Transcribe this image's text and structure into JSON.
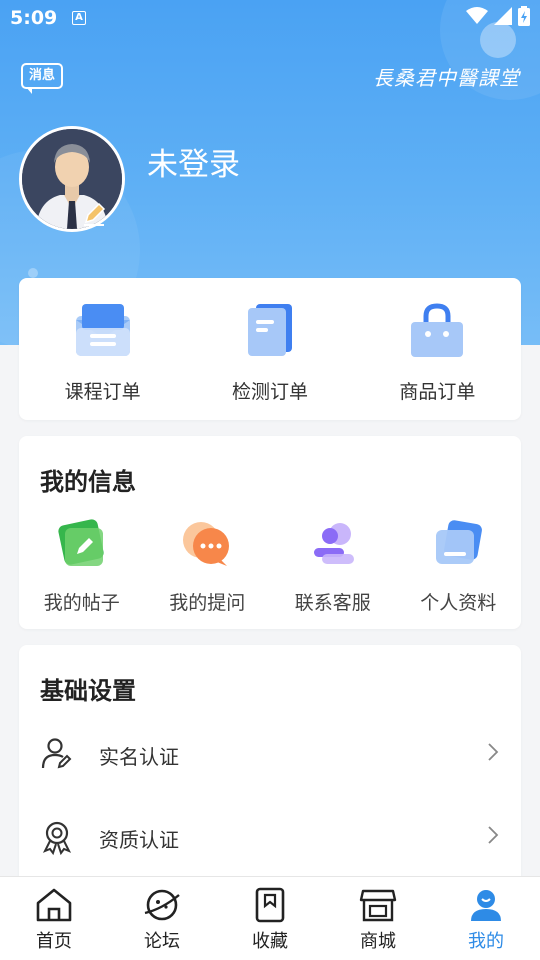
{
  "status_bar": {
    "time": "5:09",
    "notif_icon": "A"
  },
  "header": {
    "message_label": "消息",
    "brand_text": "長桑君中醫課堂",
    "login_status": "未登录"
  },
  "orders": [
    {
      "label": "课程订单",
      "icon": "course-order-icon"
    },
    {
      "label": "检测订单",
      "icon": "test-order-icon"
    },
    {
      "label": "商品订单",
      "icon": "goods-order-icon"
    }
  ],
  "my_info": {
    "title": "我的信息",
    "items": [
      {
        "label": "我的帖子",
        "icon": "post-icon"
      },
      {
        "label": "我的提问",
        "icon": "question-icon"
      },
      {
        "label": "联系客服",
        "icon": "service-icon"
      },
      {
        "label": "个人资料",
        "icon": "profile-icon"
      }
    ]
  },
  "settings": {
    "title": "基础设置",
    "items": [
      {
        "label": "实名认证",
        "icon": "user-verify-icon"
      },
      {
        "label": "资质认证",
        "icon": "certificate-icon"
      }
    ]
  },
  "tabbar": {
    "items": [
      {
        "label": "首页",
        "icon": "home-icon"
      },
      {
        "label": "论坛",
        "icon": "forum-icon"
      },
      {
        "label": "收藏",
        "icon": "bookmark-icon"
      },
      {
        "label": "商城",
        "icon": "shop-icon"
      },
      {
        "label": "我的",
        "icon": "me-icon",
        "active": true
      }
    ]
  },
  "colors": {
    "accent": "#2e8be6",
    "hero": "#4aa2f3"
  }
}
